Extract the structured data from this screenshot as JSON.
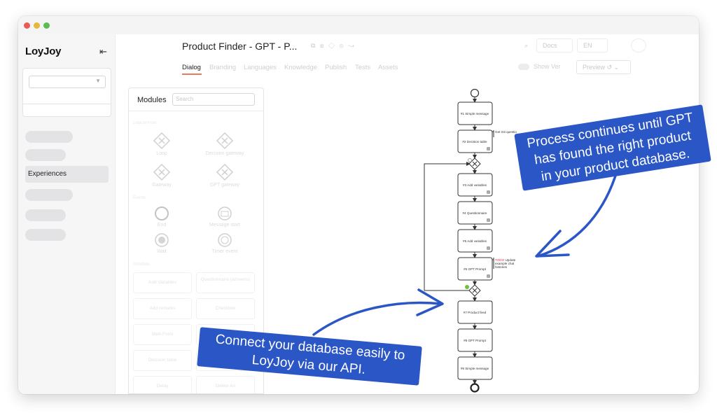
{
  "window": {
    "traffic_lights": [
      "close",
      "minimize",
      "maximize"
    ]
  },
  "sidebar": {
    "logo": "LoyJoy",
    "collapse_icon": "collapse-sidebar-icon",
    "active_item": "Experiences"
  },
  "header": {
    "title": "Product Finder - GPT - P...",
    "tabs": [
      "Dialog",
      "Branding",
      "Languages",
      "Knowledge",
      "Publish",
      "Tests",
      "Assets"
    ],
    "active_tab": "Dialog",
    "right": {
      "docs_label": "Docs",
      "lang": "EN",
      "show_label": "Show Ver",
      "preview_label": "Preview"
    }
  },
  "modules": {
    "title": "Modules",
    "search_placeholder": "Search",
    "groups": {
      "logic": "Logical Flow",
      "events": "Events",
      "activities": "Activities"
    },
    "items": {
      "loop": "Loop",
      "decision_gateway": "Decision gateway",
      "gateway": "Gateway",
      "gpt_gateway": "GPT gateway",
      "end": "End",
      "message_start": "Message start",
      "wait": "Wait",
      "timer_event": "Timer event"
    },
    "cards": [
      "Add Variables",
      "Questionnaire (answers)",
      "Add remarks",
      "Checkbox",
      "Web-Form",
      "Create Ticket",
      "Decision table",
      "Delete Variables",
      "Delay",
      "Delete Ari"
    ]
  },
  "flow": {
    "nodes": [
      "#1 Simple message",
      "#2 Decision table",
      "#3 Add variables",
      "#4 Questionnaire",
      "#5 Add variables",
      "#6 GPT Prompt",
      "#7 Product feed",
      "#8 GPT Prompt",
      "#9 Simple message"
    ],
    "note_decision": "Get Init questio",
    "note_todo": "TODO",
    "note_todo_rest": " Update",
    "note_line2": "example chat",
    "note_line3": "histories",
    "accent_green": "#6cc04a",
    "accent_orange": "#f0913a"
  },
  "annotations": {
    "top": [
      "Process continues until GPT",
      "has found the right product",
      "in your product database."
    ],
    "bottom": [
      "Connect your database easily to",
      "LoyJoy via our API."
    ],
    "color": "#2b56c6"
  }
}
